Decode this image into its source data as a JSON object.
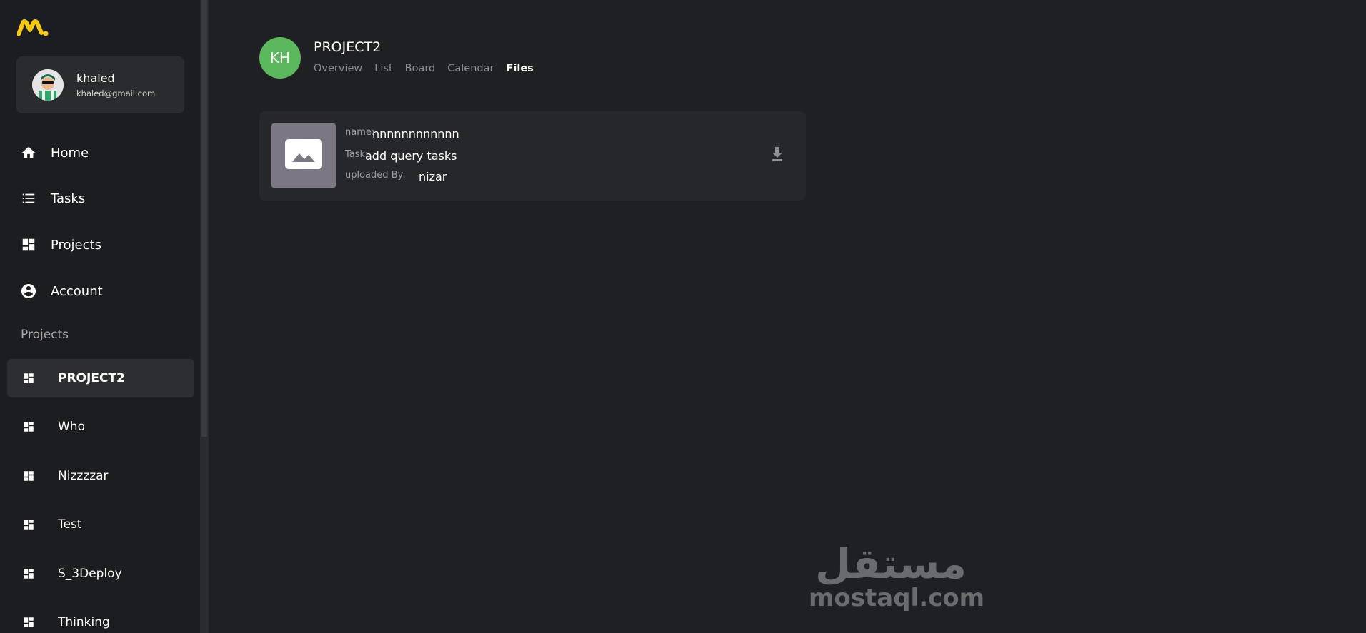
{
  "app": {
    "logo_icon": "brand-logo-icon",
    "accent_color": "#f6c915"
  },
  "user": {
    "name": "khaled",
    "email": "khaled@gmail.com"
  },
  "nav": {
    "items": [
      {
        "label": "Home",
        "icon": "home-icon"
      },
      {
        "label": "Tasks",
        "icon": "list-icon"
      },
      {
        "label": "Projects",
        "icon": "dashboard-icon"
      },
      {
        "label": "Account",
        "icon": "account-circle-icon"
      }
    ]
  },
  "projects_section": {
    "label": "Projects",
    "items": [
      {
        "label": "PROJECT2",
        "active": true
      },
      {
        "label": "Who"
      },
      {
        "label": "Nizzzzar"
      },
      {
        "label": "Test"
      },
      {
        "label": "S_3Deploy"
      },
      {
        "label": "Thinking"
      }
    ]
  },
  "header": {
    "avatar_initials": "KH",
    "avatar_color": "#5cb85c",
    "title": "PROJECT2",
    "tabs": [
      "Overview",
      "List",
      "Board",
      "Calendar",
      "Files"
    ],
    "active_tab": "Files"
  },
  "file": {
    "name_label": "name:",
    "name_value": "nnnnnnnnnnnn",
    "task_label": "Task:",
    "task_value": "add query tasks",
    "uploader_label": "uploaded By:",
    "uploader_value": "nizar",
    "thumbnail_icon": "image-icon",
    "download_icon": "download-icon"
  },
  "watermark": {
    "arabic": "مستقل",
    "latin": "mostaql.com"
  }
}
